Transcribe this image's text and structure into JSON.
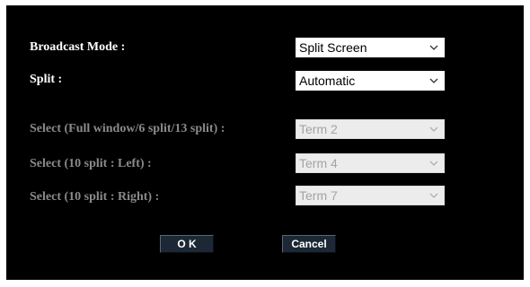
{
  "form": {
    "broadcast_mode": {
      "label": "Broadcast Mode :",
      "value": "Split Screen"
    },
    "split": {
      "label": "Split :",
      "value": "Automatic"
    },
    "select_full": {
      "label": "Select (Full window/6 split/13 split) :",
      "value": "Term 2"
    },
    "select_left": {
      "label": "Select (10 split : Left) :",
      "value": "Term 4"
    },
    "select_right": {
      "label": "Select (10 split : Right) :",
      "value": "Term 7"
    }
  },
  "buttons": {
    "ok": "O K",
    "cancel": "Cancel"
  },
  "icons": {
    "dropdown": "chevron-down-icon"
  },
  "colors": {
    "dialog_background": "#000000",
    "enabled_text": "#ffffff",
    "disabled_text": "#8a8a8a",
    "button_background": "#1d2836"
  }
}
